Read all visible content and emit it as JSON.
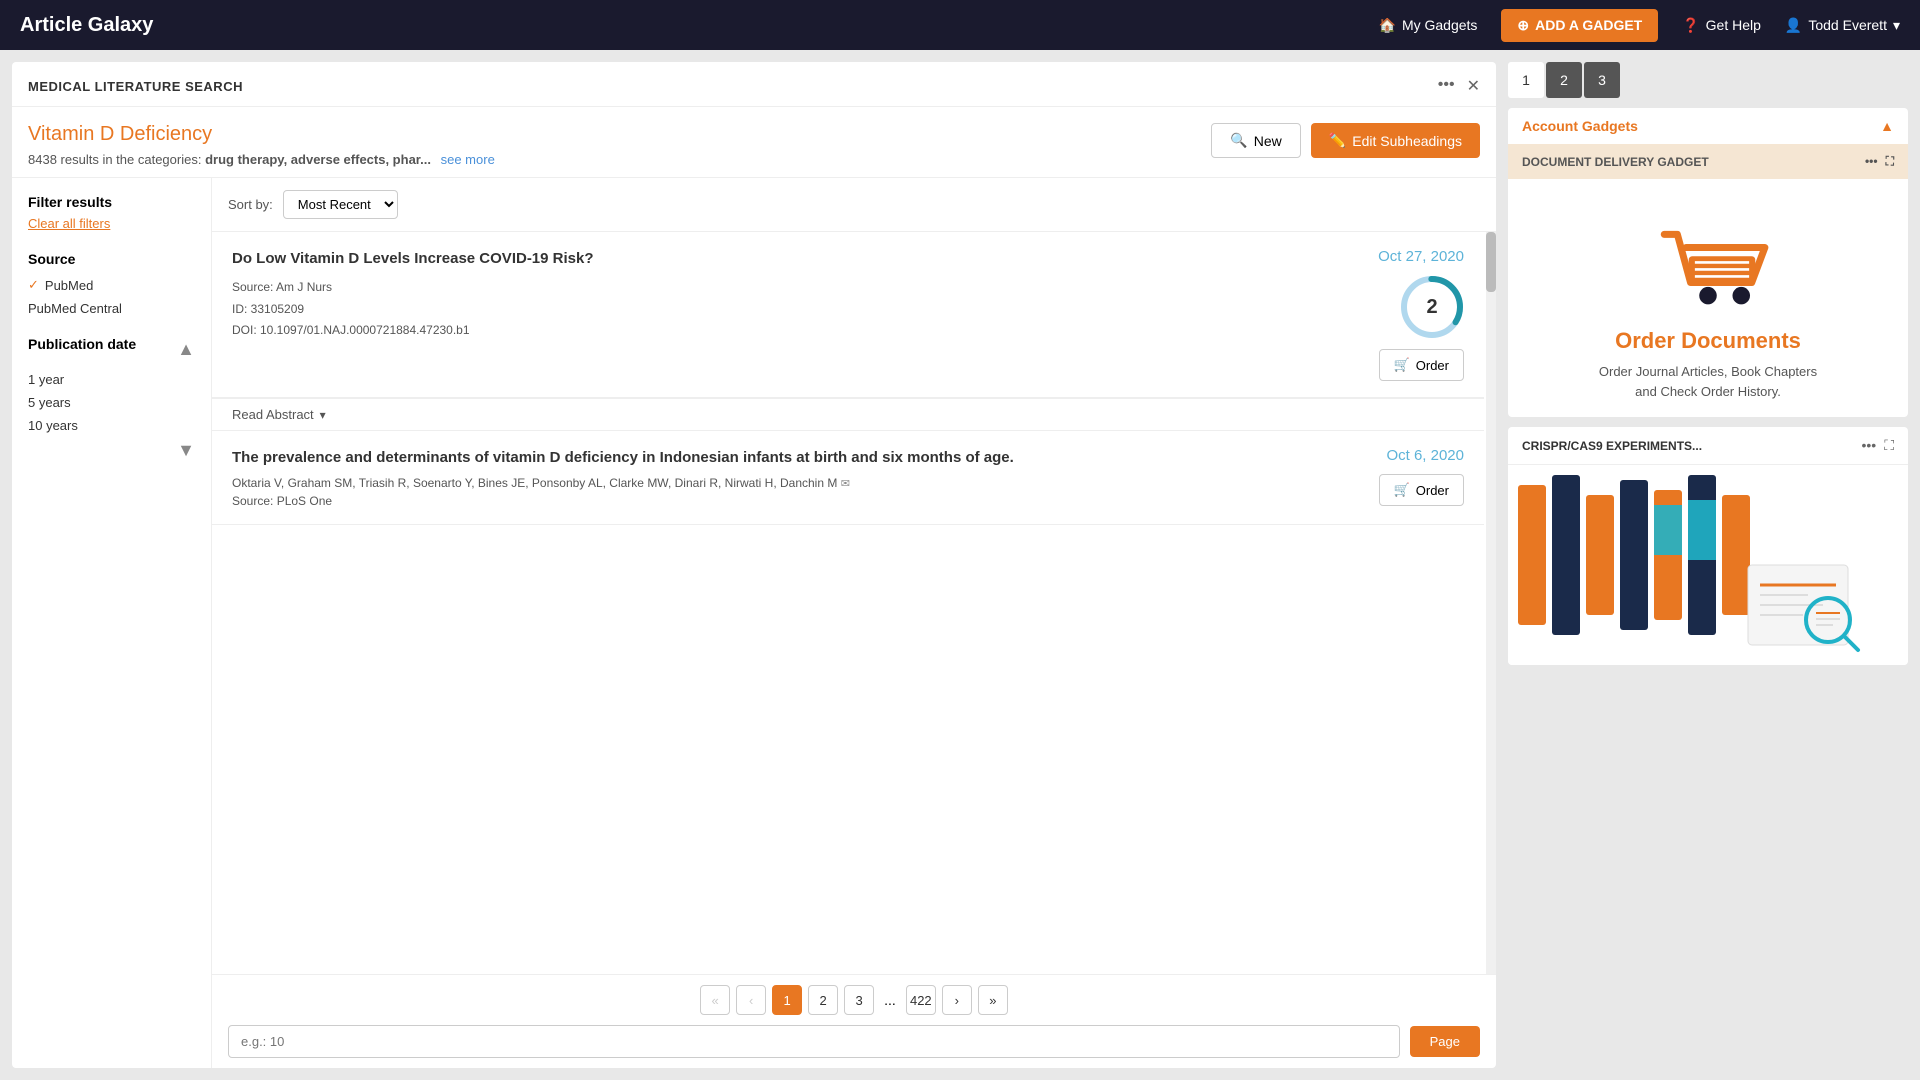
{
  "app": {
    "brand": "Article Galaxy"
  },
  "topnav": {
    "my_gadgets": "My Gadgets",
    "add_gadget": "ADD A GADGET",
    "get_help": "Get Help",
    "user": "Todd Everett"
  },
  "panel": {
    "title": "MEDICAL LITERATURE SEARCH",
    "search_title": "Vitamin D Deficiency",
    "result_count": "8438",
    "result_text": "results in the categories:",
    "result_categories": "drug therapy, adverse effects, phar...",
    "see_more": "see more",
    "btn_new": "New",
    "btn_edit_subheadings": "Edit Subheadings"
  },
  "filters": {
    "title": "Filter results",
    "clear_all": "Clear all filters",
    "source_title": "Source",
    "source_items": [
      {
        "label": "PubMed",
        "checked": true
      },
      {
        "label": "PubMed Central",
        "checked": false
      }
    ],
    "pub_date_title": "Publication date",
    "pub_date_items": [
      {
        "label": "1 year"
      },
      {
        "label": "5 years"
      },
      {
        "label": "10 years"
      }
    ]
  },
  "sort": {
    "label": "Sort by:",
    "value": "Most Recent"
  },
  "articles": [
    {
      "title": "Do Low Vitamin D Levels Increase COVID-19 Risk?",
      "date": "Oct 27, 2020",
      "citation_count": "2",
      "source": "Source: Am J Nurs",
      "id": "ID: 33105209",
      "doi": "DOI: 10.1097/01.NAJ.0000721884.47230.b1",
      "authors": "",
      "order_label": "Order"
    },
    {
      "title": "The prevalence and determinants of vitamin D deficiency in Indonesian infants at birth and six months of age.",
      "date": "Oct 6, 2020",
      "citation_count": "",
      "source": "Source: PLoS One",
      "id": "",
      "doi": "",
      "authors": "Oktaria V, Graham SM, Triasih R, Soenarto Y, Bines JE, Ponsonby AL, Clarke MW, Dinari R, Nirwati H, Danchin M",
      "order_label": "Order"
    }
  ],
  "read_abstract": "Read Abstract",
  "pagination": {
    "pages": [
      "1",
      "2",
      "3",
      "...",
      "422"
    ],
    "prev_prev": "«",
    "prev": "‹",
    "next": "›",
    "next_next": "»",
    "current": "1",
    "input_placeholder": "e.g.: 10",
    "go_label": "Page"
  },
  "right_panel": {
    "tabs": [
      "1",
      "2",
      "3"
    ],
    "gadget_title": "Account Gadgets",
    "collapse_icon": "▲",
    "doc_delivery": {
      "header": "DOCUMENT DELIVERY GADGET",
      "order_docs_title": "Order Documents",
      "order_docs_desc": "Order Journal Articles, Book Chapters\nand Check Order History."
    },
    "crispr": {
      "header": "CRISPR/CAS9 EXPERIMENTS..."
    }
  }
}
